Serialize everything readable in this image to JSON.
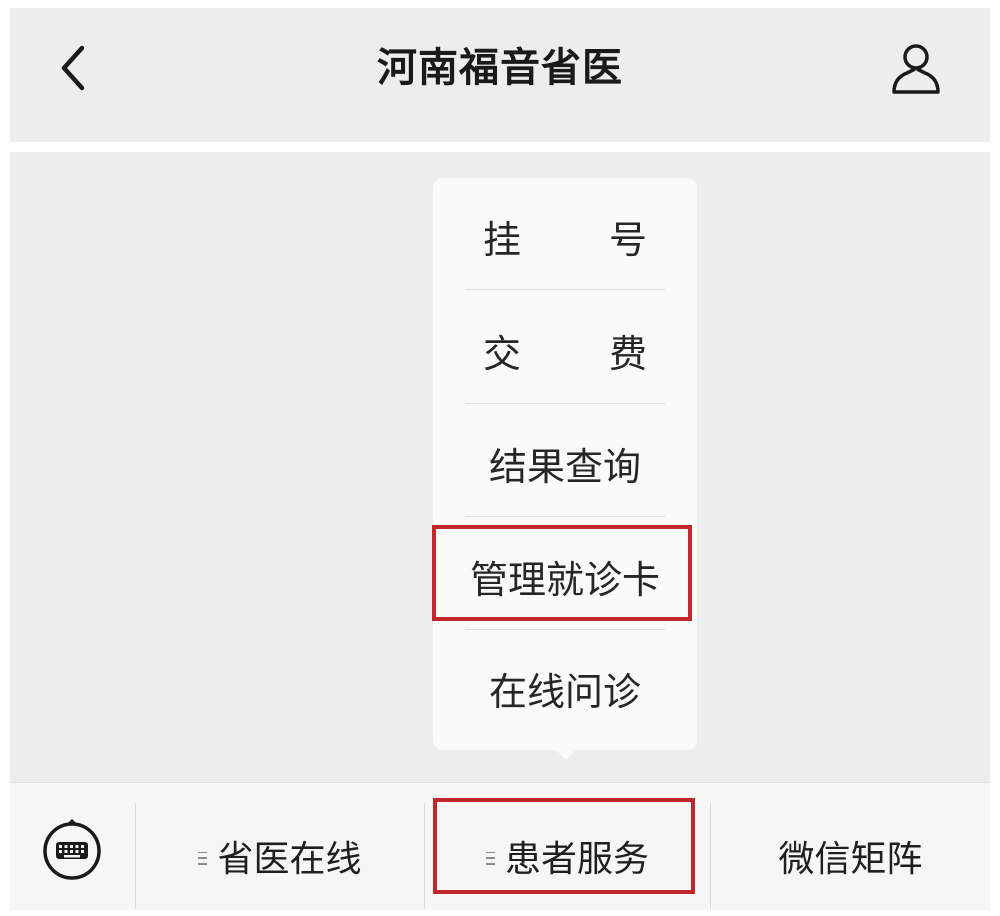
{
  "header": {
    "title": "河南福音省医",
    "back_icon": "chevron-left-icon",
    "profile_icon": "user-icon"
  },
  "popup_menu": {
    "items": [
      {
        "label_left": "挂",
        "label_right": "号"
      },
      {
        "label_left": "交",
        "label_right": "费"
      },
      {
        "label": "结果查询"
      },
      {
        "label": "管理就诊卡",
        "highlighted": true
      },
      {
        "label": "在线问诊"
      }
    ]
  },
  "bottom_bar": {
    "keyboard_icon": "keyboard-icon",
    "tabs": [
      {
        "label": "省医在线",
        "has_submenu": true
      },
      {
        "label": "患者服务",
        "has_submenu": true,
        "highlighted": true
      },
      {
        "label": "微信矩阵",
        "has_submenu": false
      }
    ]
  },
  "colors": {
    "highlight": "#c0282b",
    "panel_background": "#ededed",
    "popup_background": "#fafafa"
  }
}
